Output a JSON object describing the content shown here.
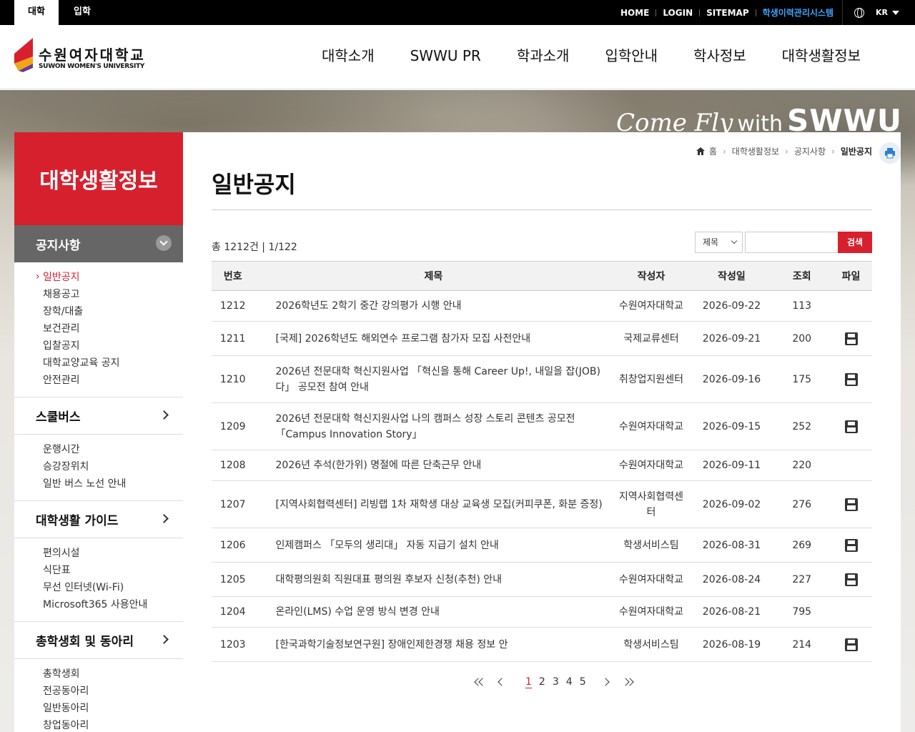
{
  "topbar": {
    "tabs": [
      "대학",
      "입학"
    ],
    "util": [
      "HOME",
      "LOGIN",
      "SITEMAP",
      "학생이력관리시스템"
    ],
    "lang": "KR"
  },
  "header": {
    "logo_kor": "수원여자대학교",
    "logo_eng": "SUWON WOMEN'S UNIVERSITY",
    "gnb": [
      "대학소개",
      "SWWU PR",
      "학과소개",
      "입학안내",
      "학사정보",
      "대학생활정보"
    ]
  },
  "hero": {
    "script": "Come Fly",
    "with": "with",
    "brand": "SWWU"
  },
  "lnb": {
    "title": "대학생활정보",
    "sections": [
      {
        "label": "공지사항",
        "items": [
          "일반공지",
          "채용공고",
          "장학/대출",
          "보건관리",
          "입찰공지",
          "대학교양교육 공지",
          "안전관리"
        ]
      },
      {
        "label": "스쿨버스",
        "items": [
          "운행시간",
          "승강장위치",
          "일반 버스 노선 안내"
        ]
      },
      {
        "label": "대학생활 가이드",
        "items": [
          "편의시설",
          "식단표",
          "무선 인터넷(Wi-Fi)",
          "Microsoft365 사용안내"
        ]
      },
      {
        "label": "총학생회 및 동아리",
        "items": [
          "총학생회",
          "전공동아리",
          "일반동아리",
          "창업동아리"
        ]
      }
    ]
  },
  "breadcrumb": [
    "홈",
    "대학생활정보",
    "공지사항",
    "일반공지"
  ],
  "page_title": "일반공지",
  "count_text": "총 1212건 | 1/122",
  "search": {
    "select": "제목",
    "button": "검색"
  },
  "table": {
    "headers": [
      "번호",
      "제목",
      "작성자",
      "작성일",
      "조회",
      "파일"
    ],
    "rows": [
      {
        "no": "1212",
        "title": "2026학년도 2학기 중간 강의평가 시행 안내",
        "writer": "수원여자대학교",
        "date": "2026-09-22",
        "views": "113",
        "file": false
      },
      {
        "no": "1211",
        "title": "[국제] 2026학년도 해외연수 프로그램 참가자 모집 사전안내",
        "writer": "국제교류센터",
        "date": "2026-09-21",
        "views": "200",
        "file": true
      },
      {
        "no": "1210",
        "title": "2026년 전문대학 혁신지원사업 「혁신을 통해 Career Up!, 내일을 잡(JOB)다」 공모전 참여 안내",
        "writer": "취창업지원센터",
        "date": "2026-09-16",
        "views": "175",
        "file": true
      },
      {
        "no": "1209",
        "title": "2026년 전문대학 혁신지원사업 나의 캠퍼스 성장 스토리 콘텐츠 공모전「Campus Innovation Story」",
        "writer": "수원여자대학교",
        "date": "2026-09-15",
        "views": "252",
        "file": true
      },
      {
        "no": "1208",
        "title": "2026년 추석(한가위) 명절에 따른 단축근무 안내",
        "writer": "수원여자대학교",
        "date": "2026-09-11",
        "views": "220",
        "file": false
      },
      {
        "no": "1207",
        "title": "[지역사회협력센터] 리빙랩 1차 재학생 대상 교육생 모집(커피쿠폰, 화분 증정)",
        "writer": "지역사회협력센터",
        "date": "2026-09-02",
        "views": "276",
        "file": true
      },
      {
        "no": "1206",
        "title": "인제캠퍼스 「모두의 생리대」 자동 지급기 설치 안내",
        "writer": "학생서비스팀",
        "date": "2026-08-31",
        "views": "269",
        "file": true
      },
      {
        "no": "1205",
        "title": "대학평의원회 직원대표 평의원 후보자 신청(추천) 안내",
        "writer": "수원여자대학교",
        "date": "2026-08-24",
        "views": "227",
        "file": true
      },
      {
        "no": "1204",
        "title": "온라인(LMS) 수업 운영 방식 변경 안내",
        "writer": "수원여자대학교",
        "date": "2026-08-21",
        "views": "795",
        "file": false
      },
      {
        "no": "1203",
        "title": "[한국과학기술정보연구원] 장애인제한경쟁 채용 정보 안",
        "writer": "학생서비스팀",
        "date": "2026-08-19",
        "views": "214",
        "file": true
      }
    ]
  },
  "pager": {
    "pages": [
      "1",
      "2",
      "3",
      "4",
      "5"
    ],
    "current": "1"
  },
  "colors": {
    "accent": "#d7202e",
    "util_link": "#3aa6ff"
  }
}
